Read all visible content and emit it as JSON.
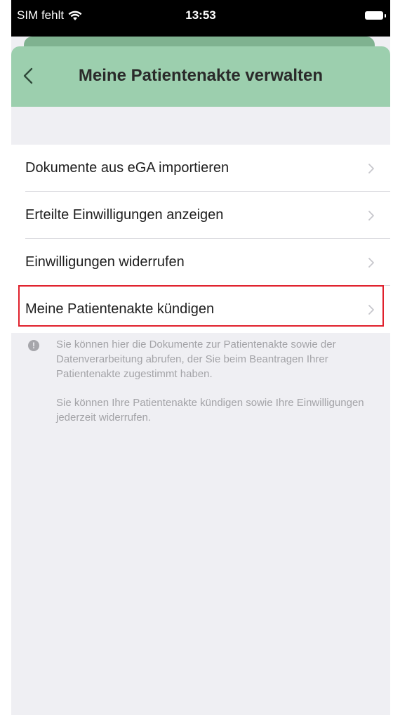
{
  "status_bar": {
    "carrier": "SIM fehlt",
    "time": "13:53"
  },
  "nav": {
    "title": "Meine Patientenakte verwalten"
  },
  "menu": {
    "items": [
      {
        "label": "Dokumente aus eGA importieren"
      },
      {
        "label": "Erteilte Einwilligungen anzeigen"
      },
      {
        "label": "Einwilligungen widerrufen"
      },
      {
        "label": "Meine Patientenakte kündigen"
      }
    ]
  },
  "info": {
    "paragraph_1": "Sie können hier die Dokumente zur Patientenakte sowie der Datenverarbeitung abrufen, der Sie beim Beantragen Ihrer Patientenakte zugestimmt haben.",
    "paragraph_2": "Sie können Ihre Patientenakte kündigen sowie Ihre Einwilligungen jederzeit widerrufen."
  },
  "colors": {
    "nav_background": "#9ccfae",
    "highlight_border": "#e0202c",
    "page_background": "#efeff3"
  }
}
